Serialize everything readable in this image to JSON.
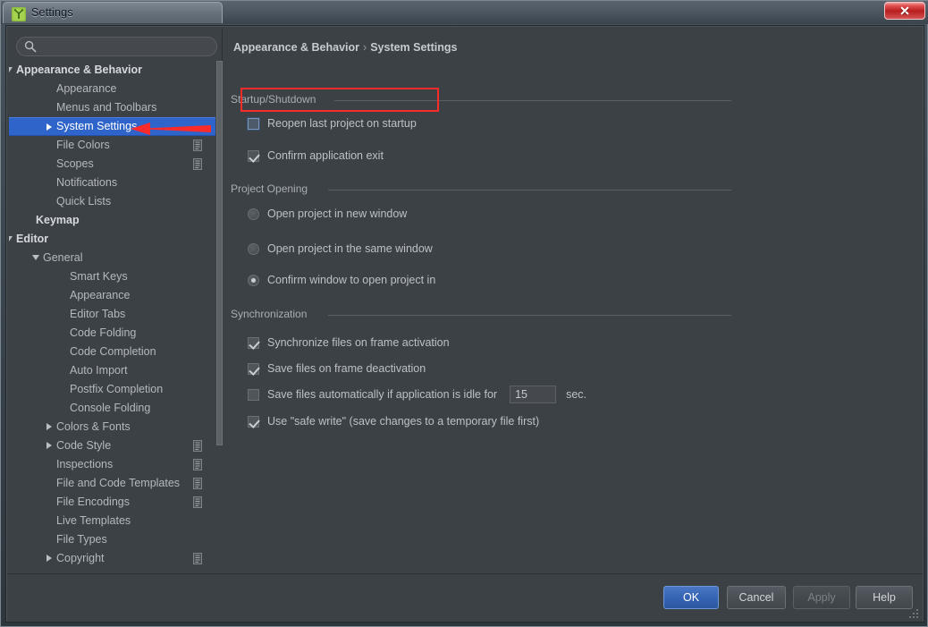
{
  "window": {
    "title": "Settings",
    "app_icon": "pycharm-icon",
    "close_label": "Close"
  },
  "sidebar": {
    "search": {
      "value": "",
      "placeholder": ""
    },
    "items": [
      {
        "label": "Appearance & Behavior",
        "indent": 8,
        "twisty": "down",
        "bold": true,
        "selected": false,
        "badge": false
      },
      {
        "label": "Appearance",
        "indent": 53,
        "twisty": "none",
        "bold": false,
        "selected": false,
        "badge": false
      },
      {
        "label": "Menus and Toolbars",
        "indent": 53,
        "twisty": "none",
        "bold": false,
        "selected": false,
        "badge": false
      },
      {
        "label": "System Settings",
        "indent": 53,
        "twisty": "right",
        "bold": false,
        "selected": true,
        "badge": false
      },
      {
        "label": "File Colors",
        "indent": 53,
        "twisty": "none",
        "bold": false,
        "selected": false,
        "badge": true
      },
      {
        "label": "Scopes",
        "indent": 53,
        "twisty": "none",
        "bold": false,
        "selected": false,
        "badge": true
      },
      {
        "label": "Notifications",
        "indent": 53,
        "twisty": "none",
        "bold": false,
        "selected": false,
        "badge": false
      },
      {
        "label": "Quick Lists",
        "indent": 53,
        "twisty": "none",
        "bold": false,
        "selected": false,
        "badge": false
      },
      {
        "label": "Keymap",
        "indent": 30,
        "twisty": "none",
        "bold": true,
        "selected": false,
        "badge": false
      },
      {
        "label": "Editor",
        "indent": 8,
        "twisty": "down",
        "bold": true,
        "selected": false,
        "badge": false
      },
      {
        "label": "General",
        "indent": 38,
        "twisty": "down",
        "bold": false,
        "selected": false,
        "badge": false
      },
      {
        "label": "Smart Keys",
        "indent": 68,
        "twisty": "none",
        "bold": false,
        "selected": false,
        "badge": false
      },
      {
        "label": "Appearance",
        "indent": 68,
        "twisty": "none",
        "bold": false,
        "selected": false,
        "badge": false
      },
      {
        "label": "Editor Tabs",
        "indent": 68,
        "twisty": "none",
        "bold": false,
        "selected": false,
        "badge": false
      },
      {
        "label": "Code Folding",
        "indent": 68,
        "twisty": "none",
        "bold": false,
        "selected": false,
        "badge": false
      },
      {
        "label": "Code Completion",
        "indent": 68,
        "twisty": "none",
        "bold": false,
        "selected": false,
        "badge": false
      },
      {
        "label": "Auto Import",
        "indent": 68,
        "twisty": "none",
        "bold": false,
        "selected": false,
        "badge": false
      },
      {
        "label": "Postfix Completion",
        "indent": 68,
        "twisty": "none",
        "bold": false,
        "selected": false,
        "badge": false
      },
      {
        "label": "Console Folding",
        "indent": 68,
        "twisty": "none",
        "bold": false,
        "selected": false,
        "badge": false
      },
      {
        "label": "Colors & Fonts",
        "indent": 53,
        "twisty": "right",
        "bold": false,
        "selected": false,
        "badge": false
      },
      {
        "label": "Code Style",
        "indent": 53,
        "twisty": "right",
        "bold": false,
        "selected": false,
        "badge": true
      },
      {
        "label": "Inspections",
        "indent": 53,
        "twisty": "none",
        "bold": false,
        "selected": false,
        "badge": true
      },
      {
        "label": "File and Code Templates",
        "indent": 53,
        "twisty": "none",
        "bold": false,
        "selected": false,
        "badge": true
      },
      {
        "label": "File Encodings",
        "indent": 53,
        "twisty": "none",
        "bold": false,
        "selected": false,
        "badge": true
      },
      {
        "label": "Live Templates",
        "indent": 53,
        "twisty": "none",
        "bold": false,
        "selected": false,
        "badge": false
      },
      {
        "label": "File Types",
        "indent": 53,
        "twisty": "none",
        "bold": false,
        "selected": false,
        "badge": false
      },
      {
        "label": "Copyright",
        "indent": 53,
        "twisty": "right",
        "bold": false,
        "selected": false,
        "badge": true
      }
    ]
  },
  "main": {
    "breadcrumb": {
      "parent": "Appearance & Behavior",
      "separator": "›",
      "current": "System Settings"
    },
    "sections": [
      {
        "title": "Startup/Shutdown",
        "options": [
          {
            "type": "checkbox",
            "label": "Reopen last project on startup",
            "checked": false,
            "focused": true
          },
          {
            "type": "checkbox",
            "label": "Confirm application exit",
            "checked": true,
            "focused": false
          }
        ]
      },
      {
        "title": "Project Opening",
        "options": [
          {
            "type": "radio",
            "label": "Open project in new window",
            "checked": false
          },
          {
            "type": "radio",
            "label": "Open project in the same window",
            "checked": false
          },
          {
            "type": "radio",
            "label": "Confirm window to open project in",
            "checked": true
          }
        ]
      },
      {
        "title": "Synchronization",
        "options": [
          {
            "type": "checkbox",
            "label": "Synchronize files on frame activation",
            "checked": true
          },
          {
            "type": "checkbox",
            "label": "Save files on frame deactivation",
            "checked": true
          },
          {
            "type": "checkbox-field",
            "label": "Save files automatically if application is idle for",
            "checked": false,
            "field_value": "15",
            "unit": "sec."
          },
          {
            "type": "checkbox",
            "label": "Use \"safe write\" (save changes to a temporary file first)",
            "checked": true
          }
        ]
      }
    ]
  },
  "footer": {
    "buttons": [
      {
        "label": "OK",
        "style": "primary",
        "disabled": false
      },
      {
        "label": "Cancel",
        "style": "normal",
        "disabled": false
      },
      {
        "label": "Apply",
        "style": "disabled",
        "disabled": true
      },
      {
        "label": "Help",
        "style": "normal",
        "disabled": false
      }
    ]
  },
  "annotations": {
    "highlight_box_target": "Reopen last project on startup",
    "arrow_target": "System Settings",
    "color": "#fb2b2b"
  }
}
